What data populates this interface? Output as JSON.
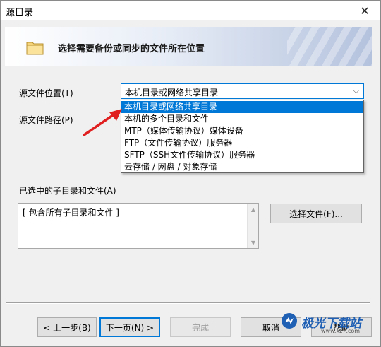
{
  "window": {
    "title": "源目录",
    "close_glyph": "✕"
  },
  "banner": {
    "text": "选择需要备份或同步的文件所在位置",
    "icon": "folder-icon"
  },
  "source_location": {
    "label": "源文件位置(T)",
    "value": "本机目录或网络共享目录",
    "options": [
      "本机目录或网络共享目录",
      "本机的多个目录和文件",
      "MTP（媒体传输协议）媒体设备",
      "FTP（文件传输协议）服务器",
      "SFTP（SSH文件传输协议）服务器",
      "云存储 / 网盘 / 对象存储"
    ],
    "selected_index": 0
  },
  "source_path": {
    "label": "源文件路径(P)"
  },
  "selected_items": {
    "label": "已选中的子目录和文件(A)",
    "content": "[ 包含所有子目录和文件 ]",
    "select_button": "选择文件(F)..."
  },
  "buttons": {
    "back": "< 上一步(B)",
    "next": "下一页(N) >",
    "finish": "完成",
    "cancel": "取消",
    "help": "帮助"
  },
  "watermark": {
    "text": "极光下载站",
    "url": "www.xz7.com"
  },
  "colors": {
    "accent": "#0078d7",
    "arrow": "#e02020"
  }
}
